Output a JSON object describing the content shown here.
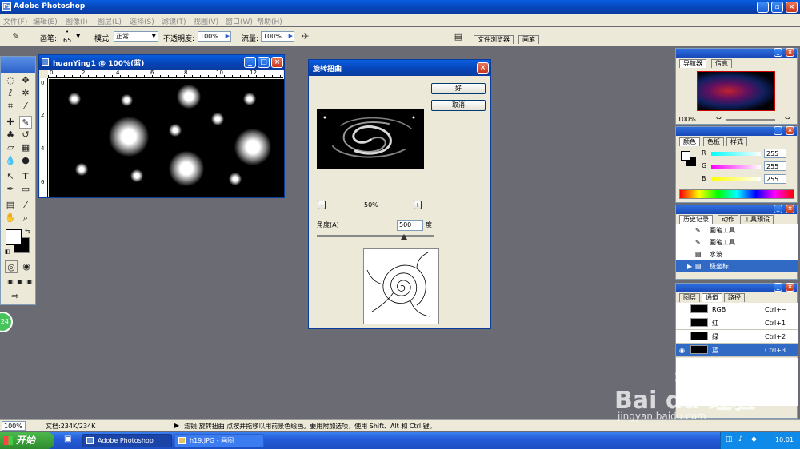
{
  "app": {
    "title": "Adobe Photoshop"
  },
  "menu": [
    "文件(F)",
    "编辑(E)",
    "图像(I)",
    "图层(L)",
    "选择(S)",
    "滤镜(T)",
    "视图(V)",
    "窗口(W)",
    "帮助(H)"
  ],
  "options": {
    "brush_label": "画笔:",
    "brush_size": "65",
    "mode_label": "模式:",
    "mode_value": "正常",
    "opacity_label": "不透明度:",
    "opacity_value": "100%",
    "flow_label": "流量:",
    "flow_value": "100%",
    "well_tabs": [
      "文件浏览器",
      "画笔"
    ]
  },
  "document": {
    "title": "huanYing1 @ 100%(蓝)",
    "ruler_h": [
      "0",
      "2",
      "4",
      "6",
      "8",
      "10",
      "12"
    ],
    "ruler_v": [
      "0",
      "2",
      "4",
      "6"
    ]
  },
  "dialog": {
    "title": "旋转扭曲",
    "ok": "好",
    "cancel": "取消",
    "zoom": "50%",
    "zoom_out": "-",
    "zoom_in": "+",
    "angle_label": "角度(A)",
    "angle_value": "500",
    "angle_unit": "度"
  },
  "navigator": {
    "tabs": [
      "导航器",
      "信息"
    ],
    "zoom": "100%"
  },
  "color": {
    "tabs": [
      "颜色",
      "色板",
      "样式"
    ],
    "channels": [
      {
        "label": "R",
        "value": "255"
      },
      {
        "label": "G",
        "value": "255"
      },
      {
        "label": "B",
        "value": "255"
      }
    ]
  },
  "history": {
    "tabs": [
      "历史记录",
      "动作",
      "工具预设"
    ],
    "items": [
      "画笔工具",
      "画笔工具",
      "水波",
      "极坐标"
    ]
  },
  "layers": {
    "tabs": [
      "图层",
      "通道",
      "路径"
    ],
    "channels": [
      {
        "name": "RGB",
        "key": "Ctrl+~"
      },
      {
        "name": "红",
        "key": "Ctrl+1"
      },
      {
        "name": "绿",
        "key": "Ctrl+2"
      },
      {
        "name": "蓝",
        "key": "Ctrl+3"
      }
    ]
  },
  "status": {
    "zoom": "100%",
    "doc": "文档:234K/234K",
    "hint": "滤镜:旋转扭曲  点按并拖移以用前景色绘画。要用附加选项，使用 Shift、Alt 和 Ctrl 键。"
  },
  "taskbar": {
    "start": "开始",
    "tasks": [
      "Adobe Photoshop",
      "h19.JPG - 画图"
    ],
    "clock": "10:01"
  },
  "watermark": {
    "brand": "Bai du 经验",
    "url": "jingyan.baidu.com"
  },
  "side_badge": "24"
}
